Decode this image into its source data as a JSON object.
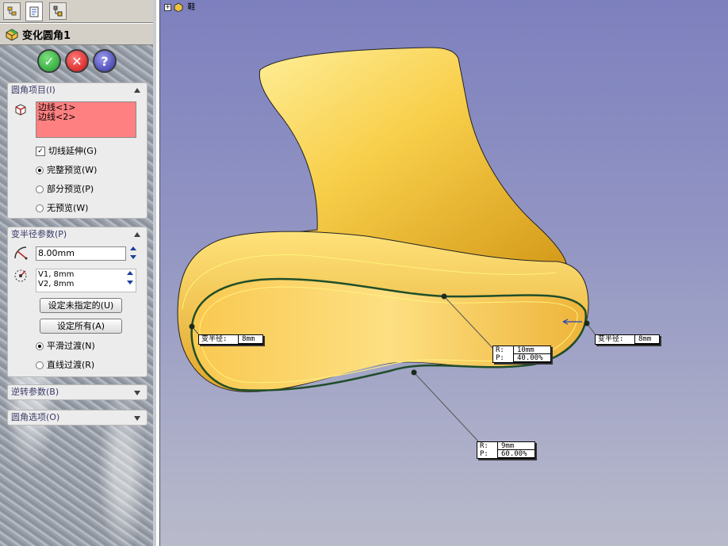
{
  "panel": {
    "title": "变化圆角1",
    "buttons": {
      "ok": "✓",
      "cancel": "✕",
      "help": "?"
    },
    "fillet_items": {
      "header": "圆角项目(I)",
      "edges": [
        "边线<1>",
        "边线<2>"
      ],
      "tangent_propagation": "切线延伸(G)",
      "preview_full": "完整预览(W)",
      "preview_partial": "部分预览(P)",
      "preview_none": "无预览(W)"
    },
    "variable_radius": {
      "header": "变半径参数(P)",
      "radius_value": "8.00mm",
      "vertices": [
        "V1, 8mm",
        "V2, 8mm"
      ],
      "set_unassigned": "设定未指定的(U)",
      "set_all": "设定所有(A)",
      "smooth": "平滑过渡(N)",
      "straight": "直线过渡(R)"
    },
    "setback": {
      "header": "逆转参数(B)"
    },
    "options": {
      "header": "圆角选项(O)"
    }
  },
  "viewport": {
    "tree_label": "鞋",
    "callouts": {
      "left": {
        "label": "变半径:",
        "value": "8mm"
      },
      "right": {
        "label": "变半径:",
        "value": "8mm"
      },
      "mid_top": {
        "r_label": "R:",
        "r_value": "10mm",
        "p_label": "P:",
        "p_value": "40.00%"
      },
      "mid_bottom": {
        "r_label": "R:",
        "r_value": "9mm",
        "p_label": "P:",
        "p_value": "60.00%"
      }
    }
  },
  "colors": {
    "selection_box": "#ff8080",
    "part": "#f5c842",
    "edge": "#1f4e2a"
  }
}
